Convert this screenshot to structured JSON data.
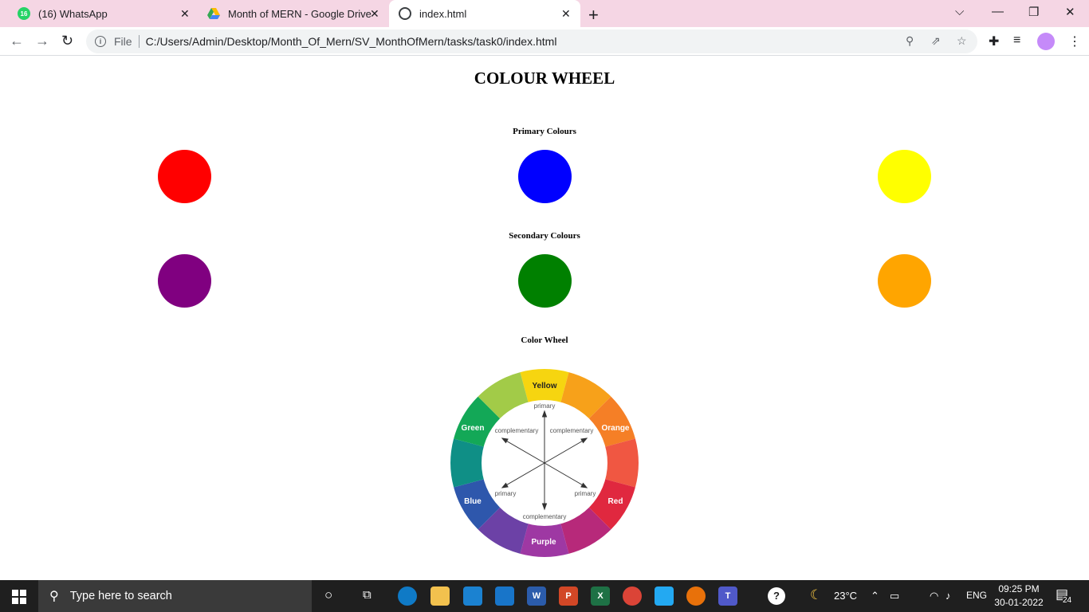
{
  "browser": {
    "tabs": [
      {
        "title": "(16) WhatsApp",
        "badge": "16",
        "icon": "whatsapp-icon"
      },
      {
        "title": "Month of MERN - Google Drive",
        "icon": "google-drive-icon"
      },
      {
        "title": "index.html",
        "icon": "globe-icon",
        "active": true
      }
    ],
    "address": {
      "scheme_label": "File",
      "url": "C:/Users/Admin/Desktop/Month_Of_Mern/SV_MonthOfMern/tasks/task0/index.html"
    }
  },
  "page": {
    "title": "COLOUR WHEEL",
    "primary": {
      "heading": "Primary Colours",
      "colors": [
        "#ff0000",
        "#0000ff",
        "#ffff00"
      ]
    },
    "secondary": {
      "heading": "Secondary Colours",
      "colors": [
        "#800080",
        "#008000",
        "#ffa500"
      ]
    },
    "wheel": {
      "heading": "Color Wheel",
      "labels": {
        "yellow": "Yellow",
        "orange": "Orange",
        "red": "Red",
        "purple": "Purple",
        "blue": "Blue",
        "green": "Green"
      },
      "inner": {
        "primary": "primary",
        "complementary": "complementary"
      }
    }
  },
  "taskbar": {
    "search_placeholder": "Type here to search",
    "weather": "23°C",
    "language": "ENG",
    "time": "09:25 PM",
    "date": "30-01-2022",
    "notifications": "24"
  }
}
